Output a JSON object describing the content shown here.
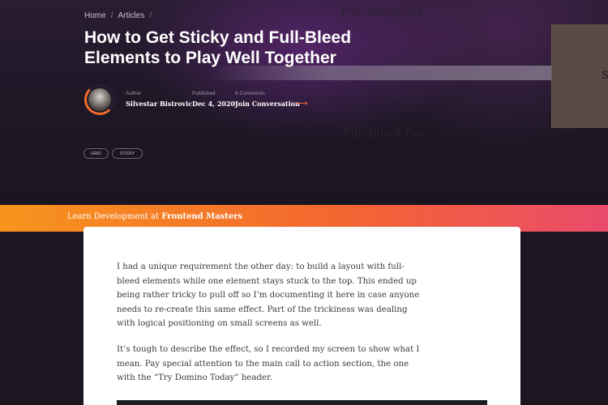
{
  "breadcrumb": {
    "home": "Home",
    "articles": "Articles",
    "sep": "/"
  },
  "title": "How to Get Sticky and Full-Bleed Elements to Play Well Together",
  "background_labels": {
    "top": "Full-bleed Box",
    "middle": "Full-bleed Box",
    "side_letter": "S"
  },
  "meta": {
    "author_label": "Author",
    "author": "Silvestar Bistrovic",
    "published_label": "Published",
    "published": "Dec 4, 2020",
    "comments_label": "6 Comments",
    "comments_link": "Join Conversation",
    "arrow": "⟶"
  },
  "tags": [
    "GRID",
    "STICKY"
  ],
  "promo": {
    "text": "Learn Development at",
    "brand": "Frontend Masters"
  },
  "article": {
    "paragraphs": [
      "I had a unique requirement the other day: to build a layout with full-bleed elements while one element stays stuck to the top. This ended up being rather tricky to pull off so I’m documenting it here in case anyone needs to re-create this same effect. Part of the trickiness was dealing with logical positioning on small screens as well.",
      "It’s tough to describe the effect, so I recorded my screen to show what I mean. Pay special attention to the main call to action section, the one with the “Try Domino Today” header."
    ]
  },
  "colors": {
    "accent": "#f36b2d",
    "promo_start": "#f7941d",
    "promo_end": "#e94b6b",
    "hero_bg": "#1b1621"
  }
}
